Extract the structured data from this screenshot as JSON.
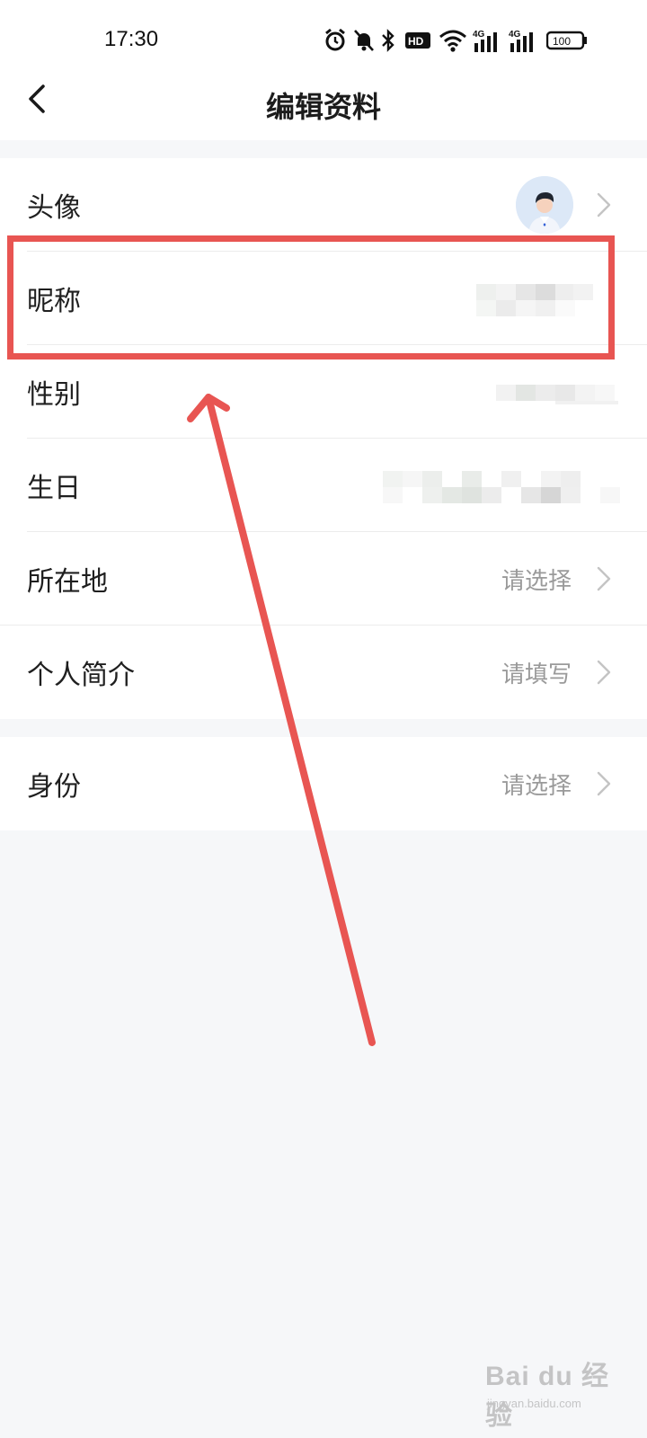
{
  "status_bar": {
    "time": "17:30",
    "icons": [
      "alarm-icon",
      "mute-icon",
      "bluetooth-icon",
      "hd-icon",
      "wifi-icon",
      "signal-4g-icon",
      "signal-4g-icon",
      "battery-icon"
    ],
    "hd_label": "HD",
    "network_label": "4G",
    "battery_level": "100"
  },
  "nav": {
    "title": "编辑资料",
    "back_icon": "chevron-left-icon"
  },
  "profile": {
    "rows": [
      {
        "label": "头像",
        "value": "",
        "kind": "avatar"
      },
      {
        "label": "昵称",
        "value": "",
        "kind": "blurred"
      },
      {
        "label": "性别",
        "value": "",
        "kind": "blurred"
      },
      {
        "label": "生日",
        "value": "",
        "kind": "blurred"
      },
      {
        "label": "所在地",
        "value": "请选择",
        "kind": "select"
      },
      {
        "label": "个人简介",
        "value": "请填写",
        "kind": "select"
      }
    ],
    "identity": {
      "label": "身份",
      "value": "请选择"
    }
  },
  "annotation": {
    "highlight_color": "#e85552",
    "arrow_color": "#e85552"
  },
  "watermark": {
    "main": "Bai du 经验",
    "sub": "jingyan.baidu.com"
  }
}
